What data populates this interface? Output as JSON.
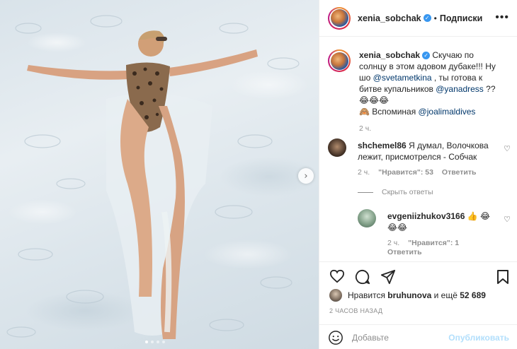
{
  "post": {
    "username": "xenia_sobchak",
    "dot": "•",
    "follow_state": "Подписки",
    "more_glyph": "•••",
    "next_glyph": "›",
    "carousel_total": 4,
    "carousel_active": 1
  },
  "caption": {
    "username": "xenia_sobchak",
    "text_1": "Скучаю по солнцу в этом адовом дубаке!!! Ну шо",
    "mention_1": "@svetametkina",
    "text_2": ", ты готова к битве купальников",
    "mention_2": "@yanadress",
    "text_3": "??😂😂😂",
    "text_4": "🙈 Вспоминая",
    "mention_3": "@joalimaldives",
    "time": "2 ч."
  },
  "comments": [
    {
      "username": "shchemel86",
      "text": "Я думал, Волочкова лежит, присмотрелся - Собчак",
      "time": "2 ч.",
      "likes": "\"Нравится\": 53",
      "reply": "Ответить",
      "hide_replies": "Скрыть ответы"
    },
    {
      "username": "evgeniizhukov3166",
      "text": "👍 😂😂😂",
      "time": "2 ч.",
      "likes": "\"Нравится\": 1",
      "reply": "Ответить"
    }
  ],
  "likes": {
    "prefix": "Нравится",
    "user": "bruhunova",
    "suffix": "и ещё",
    "count": "52 689"
  },
  "posted_ago": "2 ЧАСОВ НАЗАД",
  "add_comment": {
    "placeholder": "Добавьте",
    "publish": "Опубликовать"
  },
  "colors": {
    "accent": "#3897f0",
    "link": "#00376b",
    "muted": "#8e8e8e",
    "publish_disabled": "#b2dffc"
  },
  "icons": [
    "heart-icon",
    "comment-icon",
    "share-icon",
    "bookmark-icon",
    "verified-icon",
    "more-icon",
    "chevron-right-icon",
    "emoji-icon"
  ]
}
